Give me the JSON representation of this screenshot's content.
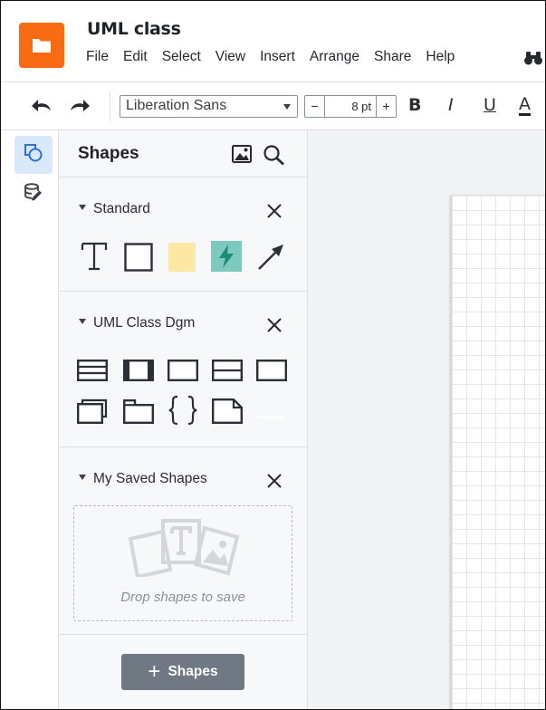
{
  "app": {
    "document_title": "UML class",
    "logo_icon": "folder-icon",
    "brand_color": "#f96b13"
  },
  "menu": {
    "items": [
      "File",
      "Edit",
      "Select",
      "View",
      "Insert",
      "Arrange",
      "Share",
      "Help"
    ],
    "find_icon": "binoculars-icon"
  },
  "toolbar": {
    "undo_icon": "undo-icon",
    "redo_icon": "redo-icon",
    "font_family": "Liberation Sans",
    "font_size": "8 pt",
    "minus_label": "−",
    "plus_label": "+",
    "bold_label": "B",
    "italic_label": "I",
    "underline_label": "U",
    "text_color_label": "A"
  },
  "rail": {
    "items": [
      {
        "icon": "shapes-icon",
        "active": true
      },
      {
        "icon": "data-linking-icon",
        "active": false
      }
    ]
  },
  "panel": {
    "title": "Shapes",
    "image_search_icon": "image-icon",
    "search_icon": "search-icon",
    "sections": [
      {
        "title": "Standard",
        "shapes": [
          "text-shape",
          "rectangle-shape",
          "sticky-note-shape",
          "action-shape",
          "arrow-shape"
        ]
      },
      {
        "title": "UML Class Dgm",
        "shapes": [
          "class-shape",
          "interface-shape",
          "simple-class-shape",
          "two-compartment-shape",
          "empty-class-shape",
          "stacked-class-shape",
          "package-shape",
          "braces-shape",
          "note-shape",
          "line-shape"
        ]
      },
      {
        "title": "My Saved Shapes",
        "drop_text": "Drop shapes to save"
      }
    ],
    "add_button_label": "Shapes"
  },
  "colors": {
    "accent": "#d9e8fb",
    "sticky": "#fde7a4",
    "action_fill": "#7cc9bd",
    "action_bolt": "#1d8c74",
    "button_bg": "#6f7883"
  }
}
